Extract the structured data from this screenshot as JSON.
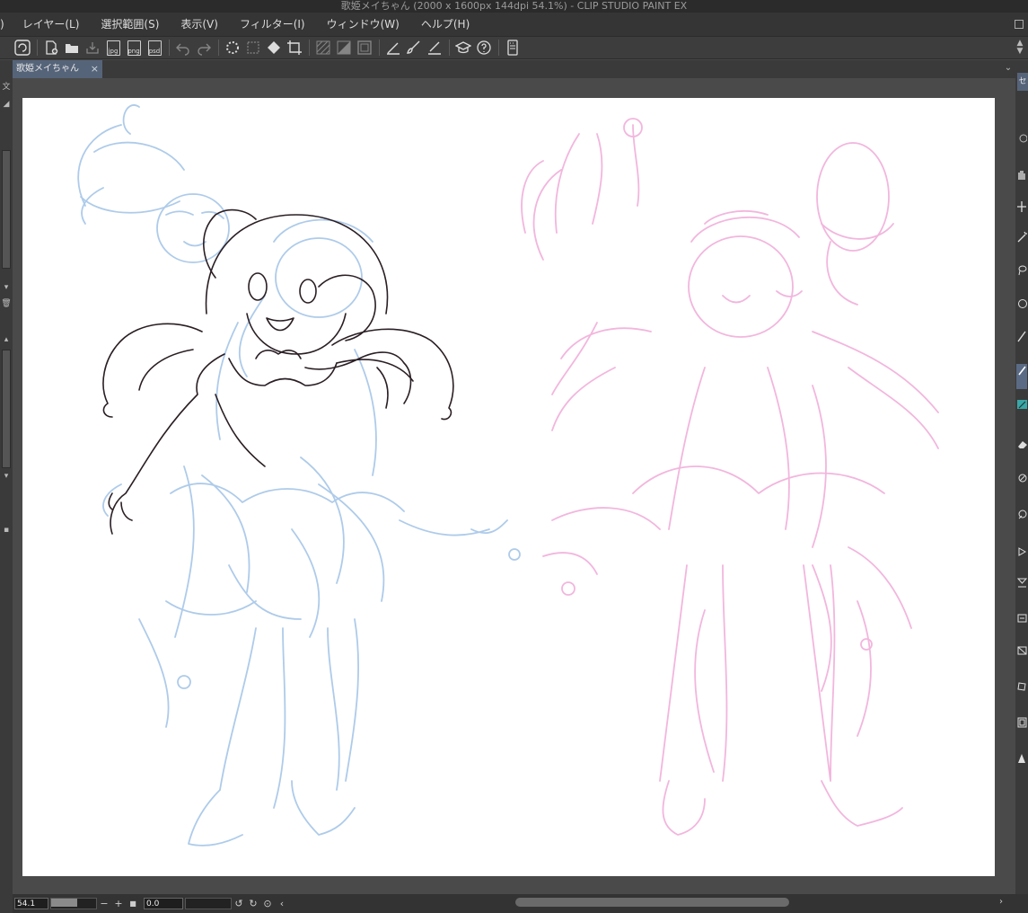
{
  "window": {
    "title": "歌姫メイちゃん (2000 x 1600px 144dpi 54.1%)  - CLIP STUDIO PAINT EX"
  },
  "menu": {
    "items": [
      ")",
      "レイヤー(L)",
      "選択範囲(S)",
      "表示(V)",
      "フィルター(I)",
      "ウィンドウ(W)",
      "ヘルプ(H)"
    ]
  },
  "toolbar": {
    "file_labels": [
      "jpg",
      "png",
      "psd"
    ],
    "icons": [
      "clip-studio-icon",
      "new-canvas-icon",
      "open-folder-icon",
      "save-icon",
      "export-jpg-icon",
      "export-png-icon",
      "export-psd-icon",
      "undo-icon",
      "redo-icon",
      "loading-icon",
      "clear-selection-icon",
      "fill-icon",
      "crop-icon",
      "hatch-icon",
      "half-icon",
      "frame-icon",
      "pen-adjust-icon",
      "brush-icon",
      "pen-pressure-icon",
      "cap-icon",
      "help-icon",
      "settings-icon"
    ]
  },
  "tab": {
    "label": "歌姫メイちゃん",
    "close": "×"
  },
  "left_strip": {
    "top_text": "文"
  },
  "right_strip": {
    "tab_label": "セ",
    "icons": [
      "eye-icon",
      "hand-icon",
      "move-icon",
      "wand-icon",
      "lasso-icon",
      "circle-select-icon",
      "pen-icon",
      "pencil-icon",
      "color-brush-icon",
      "eraser-icon",
      "blend-icon",
      "color-picker-icon",
      "play-icon",
      "text-icon",
      "transform-icon",
      "ruler-icon",
      "figure-icon",
      "frame-border-icon",
      "gradation-icon"
    ]
  },
  "status": {
    "zoom": "54.1",
    "rotation": "0.0",
    "minus": "−",
    "plus": "+",
    "stop": "■",
    "rotate_left": "↺",
    "rotate_right": "↻",
    "reset": "⊙",
    "flip": "‹",
    "scroll_right": "›"
  },
  "colors": {
    "accent_tab": "#56647a",
    "sketch_blue": "#aecbea",
    "sketch_pink": "#f2b6dd",
    "lineart": "#2a1e24"
  }
}
